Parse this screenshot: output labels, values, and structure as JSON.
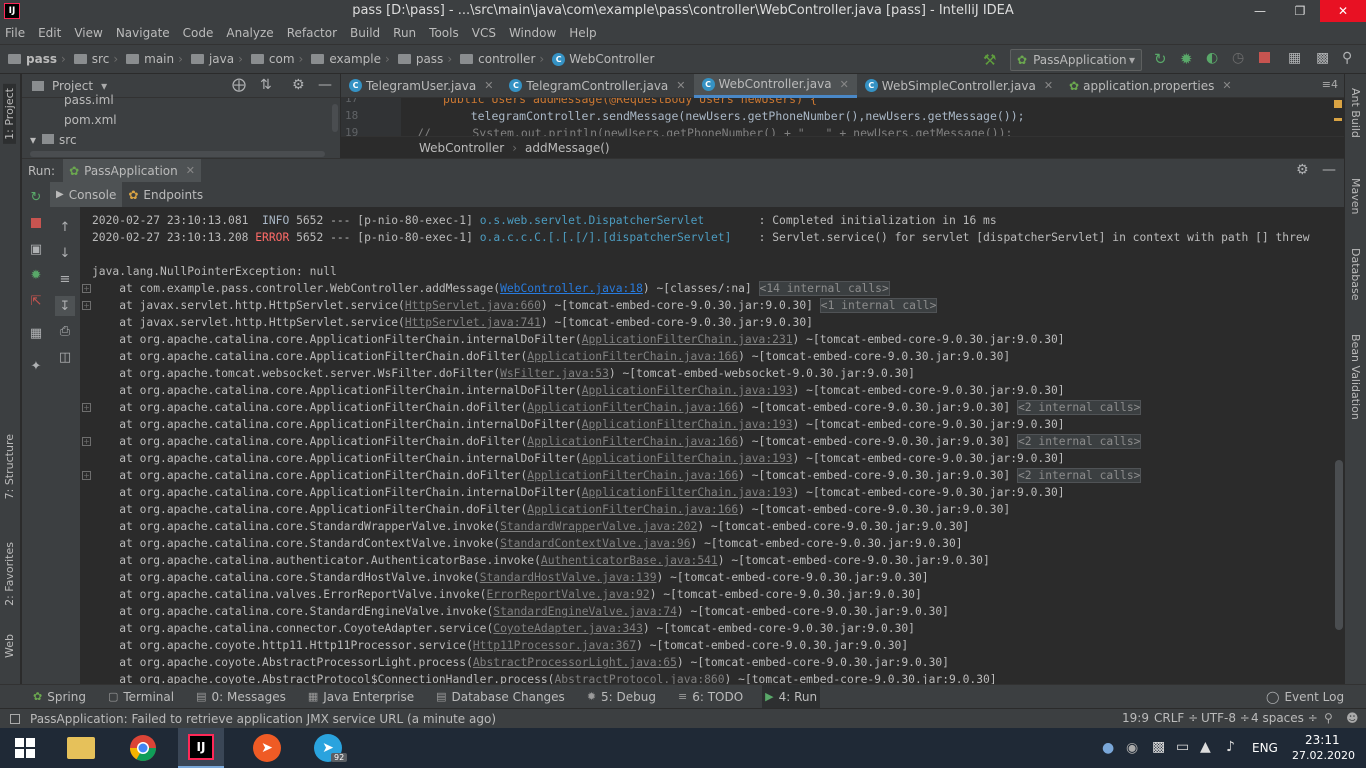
{
  "window": {
    "title": "pass [D:\\pass] - ...\\src\\main\\java\\com\\example\\pass\\controller\\WebController.java [pass] - IntelliJ IDEA",
    "logo": "IJ"
  },
  "menu": [
    "File",
    "Edit",
    "View",
    "Navigate",
    "Code",
    "Analyze",
    "Refactor",
    "Build",
    "Run",
    "Tools",
    "VCS",
    "Window",
    "Help"
  ],
  "breadcrumbs": [
    "pass",
    "src",
    "main",
    "java",
    "com",
    "example",
    "pass",
    "controller",
    "WebController"
  ],
  "run_config": "PassApplication",
  "project_panel": {
    "title": "Project",
    "items": [
      "pass.iml",
      "pom.xml",
      "src"
    ]
  },
  "editor_tabs": [
    {
      "label": "TelegramUser.java",
      "active": false
    },
    {
      "label": "TelegramController.java",
      "active": false
    },
    {
      "label": "WebController.java",
      "active": true
    },
    {
      "label": "WebSimpleController.java",
      "active": false
    },
    {
      "label": "application.properties",
      "active": false
    }
  ],
  "editor": {
    "lines": [
      {
        "num": "17",
        "text": "public Users addMessage(@RequestBody Users newUsers) {"
      },
      {
        "num": "18",
        "text": "    telegramController.sendMessage(newUsers.getPhoneNumber(),newUsers.getMessage());"
      },
      {
        "num": "19",
        "text": "//      System.out.println(newUsers.getPhoneNumber() + \"   \" + newUsers.getMessage());"
      }
    ],
    "breadcrumb": [
      "WebController",
      "addMessage()"
    ]
  },
  "run_panel": {
    "label": "Run:",
    "tab": "PassApplication",
    "subtabs": [
      "Console",
      "Endpoints"
    ]
  },
  "console": {
    "log1": {
      "ts": "2020-02-27 23:10:13.081",
      "level": "INFO",
      "pid": "5652 --- [p-nio-80-exec-1]",
      "logger": "o.s.web.servlet.DispatcherServlet",
      "msg": ": Completed initialization in 16 ms"
    },
    "log2": {
      "ts": "2020-02-27 23:10:13.208",
      "level": "ERROR",
      "pid": "5652 --- [p-nio-80-exec-1]",
      "logger": "o.a.c.c.C.[.[.[/].[dispatcherServlet]",
      "msg": ": Servlet.service() for servlet [dispatcherServlet] in context with path [] threw"
    },
    "exception": "java.lang.NullPointerException: null",
    "frames": [
      {
        "pre": "    at com.example.pass.controller.WebController.addMessage(",
        "link": "WebController.java:18",
        "post": ") ~[classes/:na] ",
        "fold": "<14 internal calls>",
        "plus": true,
        "blue": true
      },
      {
        "pre": "    at javax.servlet.http.HttpServlet.service(",
        "link": "HttpServlet.java:660",
        "post": ") ~[tomcat-embed-core-9.0.30.jar:9.0.30] ",
        "fold": "<1 internal call>",
        "plus": true
      },
      {
        "pre": "    at javax.servlet.http.HttpServlet.service(",
        "link": "HttpServlet.java:741",
        "post": ") ~[tomcat-embed-core-9.0.30.jar:9.0.30]"
      },
      {
        "pre": "    at org.apache.catalina.core.ApplicationFilterChain.internalDoFilter(",
        "link": "ApplicationFilterChain.java:231",
        "post": ") ~[tomcat-embed-core-9.0.30.jar:9.0.30]"
      },
      {
        "pre": "    at org.apache.catalina.core.ApplicationFilterChain.doFilter(",
        "link": "ApplicationFilterChain.java:166",
        "post": ") ~[tomcat-embed-core-9.0.30.jar:9.0.30]"
      },
      {
        "pre": "    at org.apache.tomcat.websocket.server.WsFilter.doFilter(",
        "link": "WsFilter.java:53",
        "post": ") ~[tomcat-embed-websocket-9.0.30.jar:9.0.30]"
      },
      {
        "pre": "    at org.apache.catalina.core.ApplicationFilterChain.internalDoFilter(",
        "link": "ApplicationFilterChain.java:193",
        "post": ") ~[tomcat-embed-core-9.0.30.jar:9.0.30]"
      },
      {
        "pre": "    at org.apache.catalina.core.ApplicationFilterChain.doFilter(",
        "link": "ApplicationFilterChain.java:166",
        "post": ") ~[tomcat-embed-core-9.0.30.jar:9.0.30] ",
        "fold": "<2 internal calls>",
        "plus": true
      },
      {
        "pre": "    at org.apache.catalina.core.ApplicationFilterChain.internalDoFilter(",
        "link": "ApplicationFilterChain.java:193",
        "post": ") ~[tomcat-embed-core-9.0.30.jar:9.0.30]"
      },
      {
        "pre": "    at org.apache.catalina.core.ApplicationFilterChain.doFilter(",
        "link": "ApplicationFilterChain.java:166",
        "post": ") ~[tomcat-embed-core-9.0.30.jar:9.0.30] ",
        "fold": "<2 internal calls>",
        "plus": true
      },
      {
        "pre": "    at org.apache.catalina.core.ApplicationFilterChain.internalDoFilter(",
        "link": "ApplicationFilterChain.java:193",
        "post": ") ~[tomcat-embed-core-9.0.30.jar:9.0.30]"
      },
      {
        "pre": "    at org.apache.catalina.core.ApplicationFilterChain.doFilter(",
        "link": "ApplicationFilterChain.java:166",
        "post": ") ~[tomcat-embed-core-9.0.30.jar:9.0.30] ",
        "fold": "<2 internal calls>",
        "plus": true
      },
      {
        "pre": "    at org.apache.catalina.core.ApplicationFilterChain.internalDoFilter(",
        "link": "ApplicationFilterChain.java:193",
        "post": ") ~[tomcat-embed-core-9.0.30.jar:9.0.30]"
      },
      {
        "pre": "    at org.apache.catalina.core.ApplicationFilterChain.doFilter(",
        "link": "ApplicationFilterChain.java:166",
        "post": ") ~[tomcat-embed-core-9.0.30.jar:9.0.30]"
      },
      {
        "pre": "    at org.apache.catalina.core.StandardWrapperValve.invoke(",
        "link": "StandardWrapperValve.java:202",
        "post": ") ~[tomcat-embed-core-9.0.30.jar:9.0.30]"
      },
      {
        "pre": "    at org.apache.catalina.core.StandardContextValve.invoke(",
        "link": "StandardContextValve.java:96",
        "post": ") ~[tomcat-embed-core-9.0.30.jar:9.0.30]"
      },
      {
        "pre": "    at org.apache.catalina.authenticator.AuthenticatorBase.invoke(",
        "link": "AuthenticatorBase.java:541",
        "post": ") ~[tomcat-embed-core-9.0.30.jar:9.0.30]"
      },
      {
        "pre": "    at org.apache.catalina.core.StandardHostValve.invoke(",
        "link": "StandardHostValve.java:139",
        "post": ") ~[tomcat-embed-core-9.0.30.jar:9.0.30]"
      },
      {
        "pre": "    at org.apache.catalina.valves.ErrorReportValve.invoke(",
        "link": "ErrorReportValve.java:92",
        "post": ") ~[tomcat-embed-core-9.0.30.jar:9.0.30]"
      },
      {
        "pre": "    at org.apache.catalina.core.StandardEngineValve.invoke(",
        "link": "StandardEngineValve.java:74",
        "post": ") ~[tomcat-embed-core-9.0.30.jar:9.0.30]"
      },
      {
        "pre": "    at org.apache.catalina.connector.CoyoteAdapter.service(",
        "link": "CoyoteAdapter.java:343",
        "post": ") ~[tomcat-embed-core-9.0.30.jar:9.0.30]"
      },
      {
        "pre": "    at org.apache.coyote.http11.Http11Processor.service(",
        "link": "Http11Processor.java:367",
        "post": ") ~[tomcat-embed-core-9.0.30.jar:9.0.30]"
      },
      {
        "pre": "    at org.apache.coyote.AbstractProcessorLight.process(",
        "link": "AbstractProcessorLight.java:65",
        "post": ") ~[tomcat-embed-core-9.0.30.jar:9.0.30]"
      },
      {
        "pre": "    at org.apache.coyote.AbstractProtocol$ConnectionHandler.process(",
        "link": "AbstractProtocol.java:860",
        "post": ") ~[tomcat-embed-core-9.0.30.jar:9.0.30]"
      }
    ]
  },
  "left_tabs": [
    "1: Project",
    "7: Structure",
    "2: Favorites",
    "Web"
  ],
  "right_tabs": [
    "Ant Build",
    "Maven",
    "Database",
    "Bean Validation"
  ],
  "bottom_tabs": [
    {
      "label": "Spring",
      "icon": "spring-icon"
    },
    {
      "label": "Terminal",
      "icon": "terminal-icon"
    },
    {
      "label": "0: Messages",
      "icon": "messages-icon"
    },
    {
      "label": "Java Enterprise",
      "icon": "java-enterprise-icon"
    },
    {
      "label": "Database Changes",
      "icon": "database-changes-icon"
    },
    {
      "label": "5: Debug",
      "icon": "debug-icon"
    },
    {
      "label": "6: TODO",
      "icon": "todo-icon"
    },
    {
      "label": "4: Run",
      "icon": "run-icon",
      "active": true
    }
  ],
  "event_log": "Event Log",
  "status": {
    "message": "PassApplication: Failed to retrieve application JMX service URL (a minute ago)",
    "position": "19:9",
    "line_sep": "CRLF ÷",
    "encoding": "UTF-8 ÷",
    "indent": "4 spaces ÷"
  },
  "taskbar": {
    "lang": "ENG",
    "time": "23:11",
    "date": "27.02.2020",
    "telegram_badge": "92"
  },
  "colors": {
    "accent": "#4a88c7",
    "link": "#287bde",
    "error": "#ff6b68",
    "close": "#e81123"
  }
}
